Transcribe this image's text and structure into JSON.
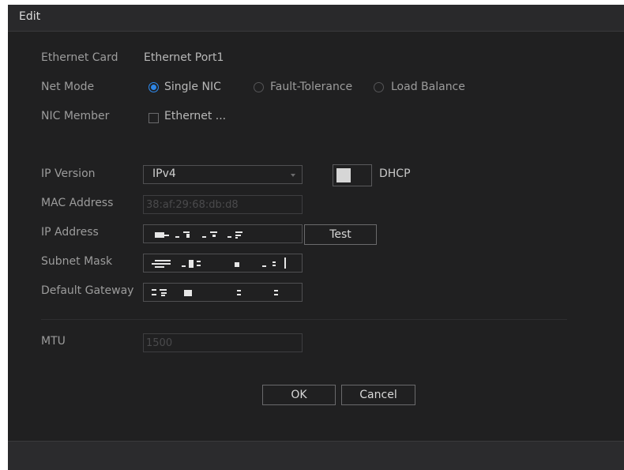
{
  "dialog": {
    "title": "Edit",
    "cancel_label": "Cancel",
    "ok_label": "OK"
  },
  "ethernet_card": {
    "label": "Ethernet Card",
    "value": "Ethernet Port1"
  },
  "net_mode": {
    "label": "Net Mode",
    "options": [
      {
        "label": "Single NIC",
        "selected": true
      },
      {
        "label": "Fault-Tolerance",
        "selected": false
      },
      {
        "label": "Load Balance",
        "selected": false
      }
    ]
  },
  "nic_member": {
    "label": "NIC Member",
    "option_label": "Ethernet ...",
    "checked": false
  },
  "ip_version": {
    "label": "IP Version",
    "value": "IPv4"
  },
  "dhcp": {
    "label": "DHCP",
    "enabled": false
  },
  "mac_address": {
    "label": "MAC Address",
    "value": "38:af:29:68:db:d8"
  },
  "ip_address": {
    "label": "IP Address",
    "value": "",
    "test_label": "Test"
  },
  "subnet_mask": {
    "label": "Subnet Mask",
    "value": ""
  },
  "default_gateway": {
    "label": "Default Gateway",
    "value": ""
  },
  "mtu": {
    "label": "MTU",
    "value": "1500"
  },
  "colors": {
    "accent": "#2e86e6",
    "background": "#202021",
    "titlebar": "#29292b"
  }
}
